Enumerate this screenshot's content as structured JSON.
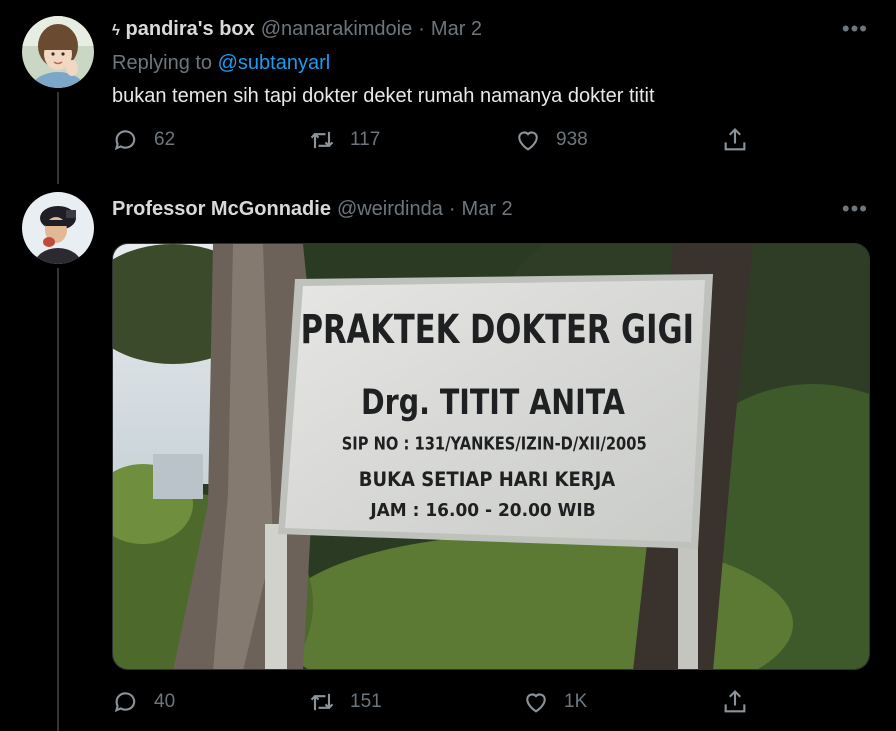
{
  "tweets": [
    {
      "name_prefix": "ϟ",
      "name": "pandira's box",
      "handle": "@nanarakimdoie",
      "separator": "·",
      "date": "Mar 2",
      "replying_label": "Replying to",
      "replying_to": "@subtanyarl",
      "text": "bukan temen sih tapi dokter deket rumah namanya dokter titit",
      "replies": "62",
      "retweets": "117",
      "likes": "938"
    },
    {
      "name": "Professor McGonnadie",
      "handle": "@weirdinda",
      "separator": "·",
      "date": "Mar 2",
      "replies": "40",
      "retweets": "151",
      "likes": "1K",
      "image": {
        "sign_line1": "PRAKTEK DOKTER GIGI",
        "sign_line2": "Drg. TITIT ANITA",
        "sign_line3": "SIP NO : 131/YANKES/IZIN-D/XII/2005",
        "sign_line4": "BUKA SETIAP HARI KERJA",
        "sign_line5": "JAM : 16.00 - 20.00 WIB"
      }
    }
  ],
  "icons": {
    "more": "more-icon",
    "reply": "reply-icon",
    "retweet": "retweet-icon",
    "like": "heart-icon",
    "share": "share-icon"
  },
  "more_label": "•••",
  "colors": {
    "background": "#000000",
    "accent": "#1d9bf0",
    "muted": "#6e767d",
    "text": "#e7e9ea"
  }
}
